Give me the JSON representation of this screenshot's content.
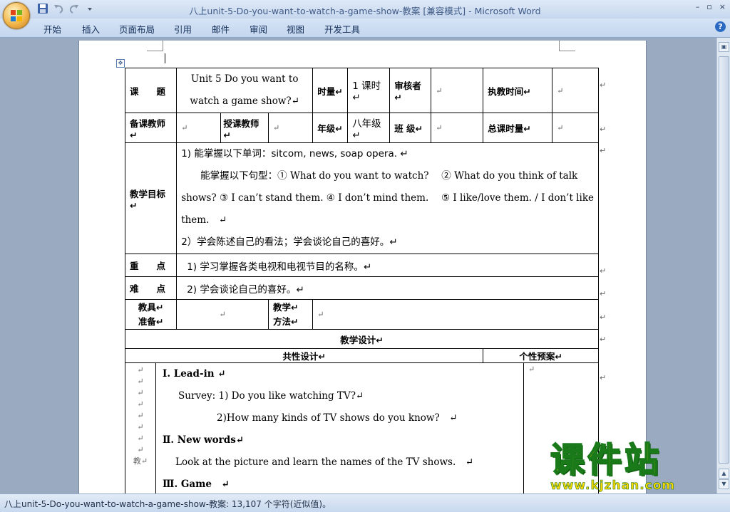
{
  "window": {
    "title": "八上unit-5-Do-you-want-to-watch-a-game-show-教案 [兼容模式] - Microsoft Word",
    "controls": [
      "–",
      "▫",
      "×"
    ]
  },
  "ribbon": {
    "tabs": [
      "开始",
      "插入",
      "页面布局",
      "引用",
      "邮件",
      "审阅",
      "视图",
      "开发工具"
    ],
    "help": "?"
  },
  "table": {
    "r1": {
      "c1": "课　　题",
      "c2a": "Unit 5 Do you want to",
      "c2b": "watch a game show?↵",
      "c3": "时量↵",
      "c4": "1 课时↵",
      "c5": "审核者↵",
      "c6": "↵",
      "c7": "执教时间↵",
      "c8": "↵"
    },
    "r2": {
      "c1": "备课教师↵",
      "c2": "↵",
      "c3": "授课教师↵",
      "c4": "↵",
      "c5": "年级↵",
      "c6": "八年级↵",
      "c7": "班 级↵",
      "c8": "↵",
      "c9": "总课时量↵",
      "c10": "↵"
    },
    "r3": {
      "label": "教学目标↵",
      "l1": "1) 能掌握以下单词：sitcom, news, soap opera. ↵",
      "l2": "　　能掌握以下句型：① What do you want to watch?　 ② What do you think of talk",
      "l3": "shows? ③ I can’t stand them. ④ I don’t mind them.　 ⑤ I like/love them. / I don’t like",
      "l4": "them.　↵",
      "l5": "2）学会陈述自己的看法；学会谈论自己的喜好。↵"
    },
    "r4": {
      "label": "重　　点",
      "content": "1) 学习掌握各类电视和电视节目的名称。↵"
    },
    "r5": {
      "label": "难　　点",
      "content": "2) 学会谈论自己的喜好。↵"
    },
    "r6": {
      "c1a": "教具↵",
      "c1b": "准备↵",
      "c2": "↵",
      "c3a": "教学↵",
      "c3b": "方法↵",
      "c4": "↵"
    },
    "r7": {
      "label": "教学设计↵"
    },
    "r8": {
      "common": "共性设计↵",
      "personal": "个性预案↵"
    },
    "r9": {
      "marks": "↵\n↵\n↵\n↵\n↵\n↵\n↵\n↵\n教↵",
      "h1": "Ⅰ. Lead-in ↵",
      "s1": "Survey: 1) Do you like watching TV?↵",
      "s2": "2)How many kinds of TV shows do you know?　↵",
      "h2": "Ⅱ. New words↵",
      "s3": "Look at the picture and learn the names of the TV shows.　↵",
      "h3": "Ⅲ. Game　↵",
      "personal": "↵"
    }
  },
  "watermark": {
    "main": "课件站",
    "url": "www.kjzhan.com"
  },
  "status": {
    "text": "八上unit-5-Do-you-want-to-watch-a-game-show-教案: 13,107 个字符(近似值)。"
  }
}
